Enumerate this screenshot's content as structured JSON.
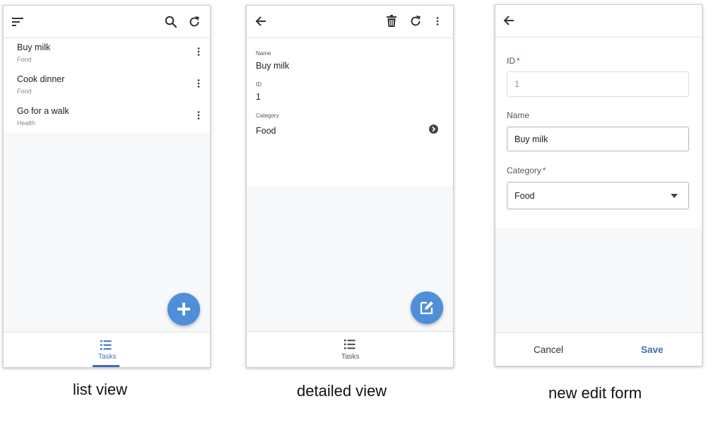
{
  "list_view": {
    "items": [
      {
        "title": "Buy milk",
        "category": "Food"
      },
      {
        "title": "Cook dinner",
        "category": "Food"
      },
      {
        "title": "Go for a walk",
        "category": "Health"
      }
    ],
    "nav_tab": "Tasks",
    "caption": "list view"
  },
  "detail_view": {
    "fields": [
      {
        "label": "Name",
        "value": "Buy milk"
      },
      {
        "label": "ID",
        "value": "1"
      },
      {
        "label": "Category",
        "value": "Food"
      }
    ],
    "nav_tab": "Tasks",
    "caption": "detailed view"
  },
  "edit_form": {
    "id_label": "ID",
    "id_value": "1",
    "name_label": "Name",
    "name_value": "Buy milk",
    "category_label": "Category",
    "category_value": "Food",
    "required_marker": "*",
    "cancel_label": "Cancel",
    "save_label": "Save",
    "caption": "new edit form"
  },
  "colors": {
    "accent": "#4f8fd9",
    "accent_text": "#3d6fb3",
    "required": "#dd3333"
  }
}
